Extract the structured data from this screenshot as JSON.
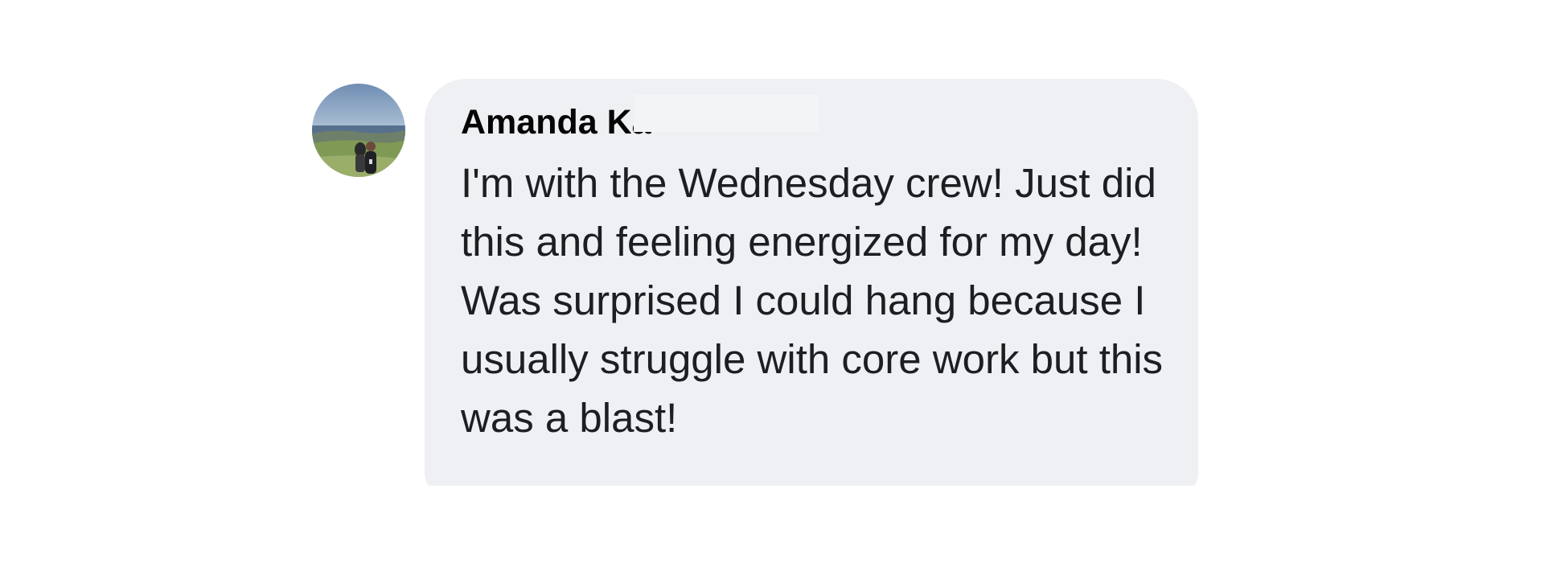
{
  "comment": {
    "author_name": "Amanda Ka",
    "text": "I'm with the Wednesday crew! Just did this and feeling energized for my day! Was surprised I could hang because I usually struggle with core work but this was a blast!",
    "avatar_icon": "profile-photo-avatar"
  },
  "colors": {
    "bubble_background": "#eff0f3",
    "text": "#1c1e21",
    "author": "#050505",
    "page_background": "#ffffff"
  }
}
